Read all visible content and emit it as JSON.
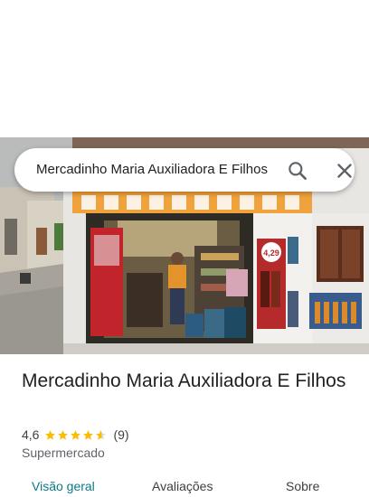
{
  "search": {
    "query": "Mercadinho Maria Auxiliadora E Filhos",
    "search_icon": "search-icon",
    "close_icon": "close-icon"
  },
  "place": {
    "name": "Mercadinho Maria Auxiliadora E Filhos",
    "rating": "4,6",
    "rating_stars_value": 4.6,
    "review_count": "(9)",
    "category": "Supermercado"
  },
  "tabs": [
    {
      "label": "Visão geral",
      "active": true
    },
    {
      "label": "Avaliações",
      "active": false
    },
    {
      "label": "Sobre",
      "active": false
    }
  ],
  "photo": {
    "price_sign": "4,29"
  },
  "colors": {
    "accent": "#0b7a87",
    "star": "#fbbc04",
    "wall_orange": "#f0a23c"
  }
}
